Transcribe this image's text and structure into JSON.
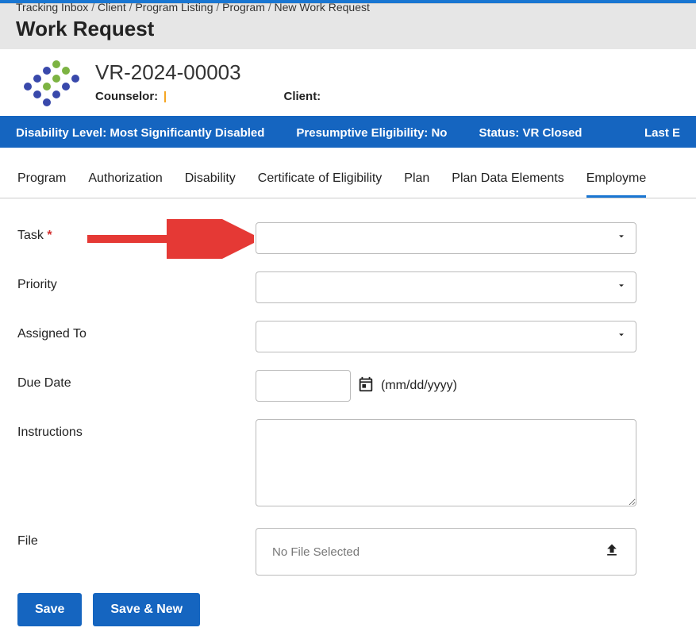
{
  "breadcrumb": {
    "items": [
      "Tracking Inbox",
      "Client",
      "Program Listing",
      "Program",
      "New Work Request"
    ]
  },
  "page_title": "Work Request",
  "case": {
    "number": "VR-2024-00003",
    "counselor_label": "Counselor:",
    "client_label": "Client:"
  },
  "status_bar": {
    "disability": "Disability Level: Most Significantly Disabled",
    "presumptive": "Presumptive Eligibility: No",
    "status": "Status: VR Closed",
    "last": "Last E"
  },
  "tabs": {
    "items": [
      "Program",
      "Authorization",
      "Disability",
      "Certificate of Eligibility",
      "Plan",
      "Plan Data Elements",
      "Employme"
    ],
    "active_index": 6
  },
  "form": {
    "task_label": "Task",
    "priority_label": "Priority",
    "assigned_to_label": "Assigned To",
    "due_date_label": "Due Date",
    "due_date_hint": "(mm/dd/yyyy)",
    "instructions_label": "Instructions",
    "file_label": "File",
    "file_placeholder": "No File Selected"
  },
  "buttons": {
    "save": "Save",
    "save_new": "Save & New"
  }
}
